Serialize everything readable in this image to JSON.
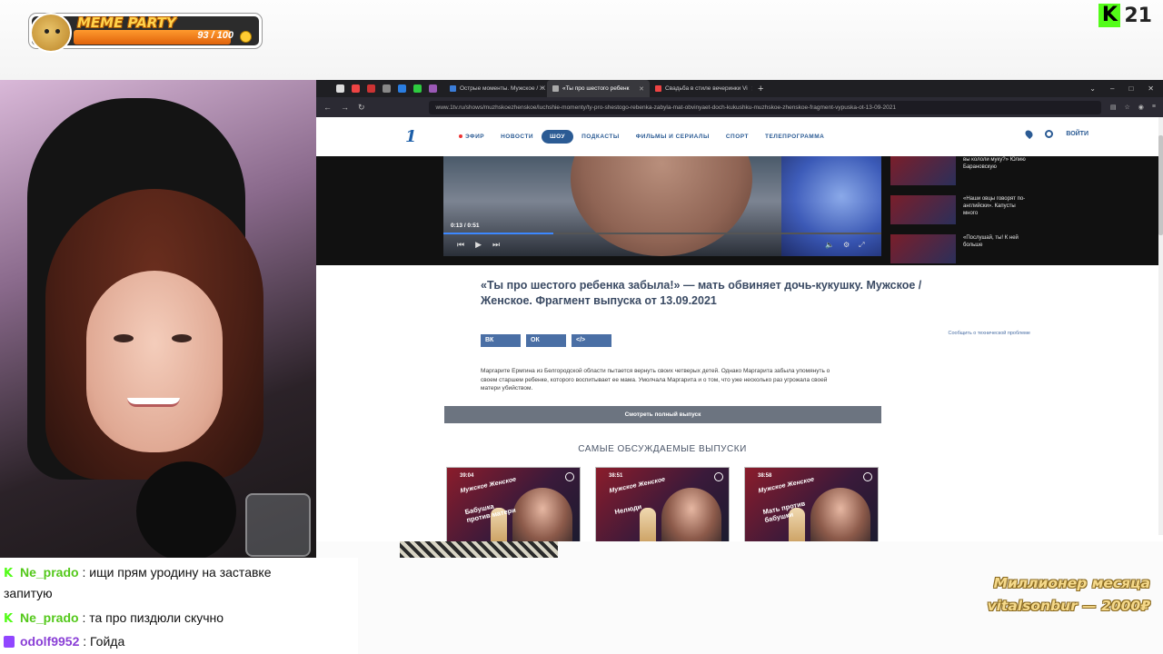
{
  "overlay": {
    "meme_title": "MEME PARTY",
    "meme_count": "93 / 100",
    "meme_progress": 0.93,
    "kick_count": "21",
    "kick_letter": "K"
  },
  "browser": {
    "tabs": [
      {
        "label": "Острые моменты. Мужское / Ж",
        "active": false
      },
      {
        "label": "«Ты про шестого ребенк",
        "active": true
      },
      {
        "label": "Свадьба в стиле вечеринки Vi",
        "active": false
      }
    ],
    "new_tab": "+",
    "url": "www.1tv.ru/shows/muzhskoezhenskoe/luchshie-momenty/ty-pro-shestogo-rebenka-zabyla-mat-obvinyaet-doch-kukushku-muzhskoe-zhenskoe-fragment-vypuska-ot-13-09-2021"
  },
  "site": {
    "logo": "1",
    "nav": [
      "ЭФИР",
      "НОВОСТИ",
      "ШОУ",
      "ПОДКАСТЫ",
      "ФИЛЬМЫ И СЕРИАЛЫ",
      "СПОРТ",
      "ТЕЛЕПРОГРАММА"
    ],
    "login": "ВОЙТИ",
    "player": {
      "time": "0:13 / 0:51",
      "progress": 0.25
    },
    "side_items": [
      {
        "text": "вы кололи муку?» Юлию Барановскую"
      },
      {
        "text": "«Наши овцы говорят по-английски». Капусты много"
      },
      {
        "text": "«Послушай, ты! К ней больше"
      }
    ],
    "headline": "«Ты про шестого ребенка забыла!» — мать обвиняет дочь-кукушку. Мужское / Женское. Фрагмент выпуска от 13.09.2021",
    "share": [
      "ВК",
      "ОК",
      "</>"
    ],
    "report": "Сообщить о технической проблеме",
    "description": "Маргарите Ермгина из Белгородской области пытается вернуть своих четверых детей. Однако Маргарита забыла упомянуть о своем старшем ребенке, которого воспитывает ее мама. Умолчала Маргарита и о том, что уже несколько раз угрожала своей матери убийством.",
    "watch_full": "Смотреть полный выпуск",
    "section_title": "САМЫЕ ОБСУЖДАЕМЫЕ ВЫПУСКИ",
    "cards": [
      {
        "duration": "39:04",
        "brand": "Мужское Женское",
        "title": "Бабушка против матери"
      },
      {
        "duration": "38:51",
        "brand": "Мужское Женское",
        "title": "Нелюди"
      },
      {
        "duration": "38:58",
        "brand": "Мужское Женское",
        "title": "Мать против бабушки"
      }
    ]
  },
  "chat": [
    {
      "platform": "kick",
      "user": "Ne_prado",
      "text": ": ищи прям уродину на заставке"
    },
    {
      "platform": "none",
      "user": "",
      "text": "запитую"
    },
    {
      "platform": "kick",
      "user": "Ne_prado",
      "text": ": та про пиздюли скучно"
    },
    {
      "platform": "twitch",
      "user": "odolf9952",
      "text": ": Гойда"
    }
  ],
  "millionaire": {
    "line1": "Миллионер месяца",
    "line2": "vitalsonbur — 2000₽"
  }
}
